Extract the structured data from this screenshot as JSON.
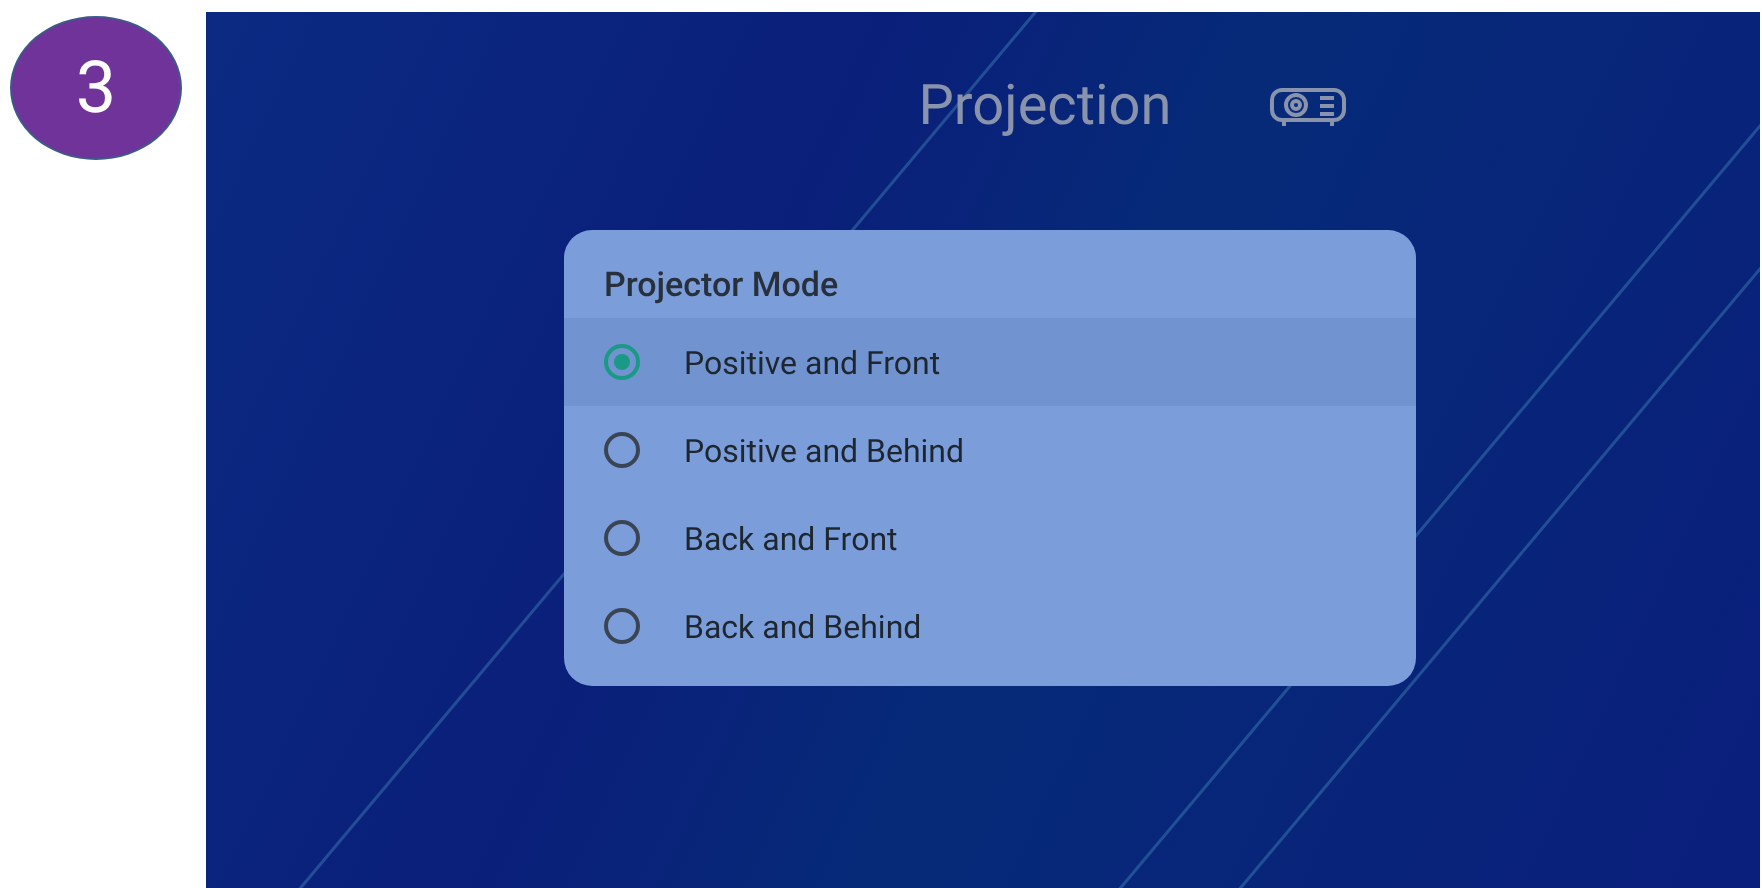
{
  "step_badge": "3",
  "screen": {
    "title": "Projection"
  },
  "dialog": {
    "title": "Projector Mode",
    "options": [
      {
        "label": "Positive and Front",
        "selected": true
      },
      {
        "label": "Positive and Behind",
        "selected": false
      },
      {
        "label": "Back and Front",
        "selected": false
      },
      {
        "label": "Back and Behind",
        "selected": false
      }
    ]
  }
}
